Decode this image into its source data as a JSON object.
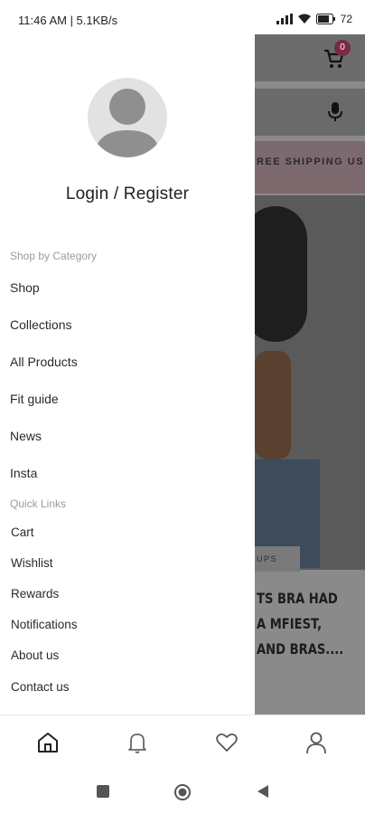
{
  "status_bar": {
    "time_speed": "11:46 AM | 5.1KB/s",
    "battery": "72"
  },
  "background_app": {
    "cart_count": "0",
    "promo_text": "REE SHIPPING US",
    "blog_tag": "UPS",
    "blog_title": "TS BRA HAD A MFIEST, AND BRAS...."
  },
  "drawer": {
    "login_label": "Login / Register",
    "shop_by_category_heading": "Shop by Category",
    "category_items": [
      {
        "label": "Shop"
      },
      {
        "label": "Collections"
      },
      {
        "label": "All Products"
      },
      {
        "label": "Fit guide"
      },
      {
        "label": "News"
      },
      {
        "label": "Insta"
      }
    ],
    "quick_links_heading": "Quick Links",
    "quick_links": [
      {
        "label": "Cart"
      },
      {
        "label": "Wishlist"
      },
      {
        "label": "Rewards"
      },
      {
        "label": "Notifications"
      },
      {
        "label": "About us"
      },
      {
        "label": "Contact us"
      }
    ]
  },
  "bottom_nav": {
    "icons": [
      "home-icon",
      "bell-icon",
      "heart-icon",
      "user-icon"
    ]
  },
  "colors": {
    "cart_badge": "#7a2a45",
    "overlay": "#8a8a8a"
  }
}
